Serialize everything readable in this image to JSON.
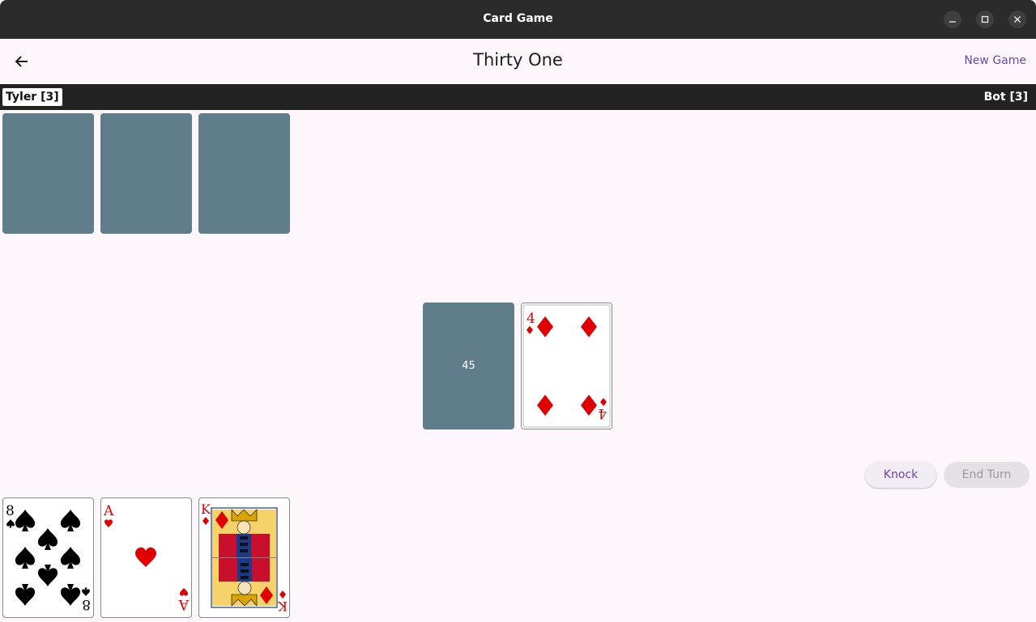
{
  "window": {
    "title": "Card Game",
    "controls": [
      "minimize-icon",
      "maximize-icon",
      "close-icon"
    ]
  },
  "appbar": {
    "back_icon": "arrow-left-icon",
    "title": "Thirty One",
    "new_game_label": "New Game"
  },
  "players": {
    "left": "Tyler [3]",
    "right": "Bot [3]"
  },
  "opponent_hand": {
    "card_count": 3,
    "face": "down"
  },
  "deck": {
    "count": "45"
  },
  "discard": {
    "rank": "4",
    "suit": "diamonds"
  },
  "actions": {
    "knock_label": "Knock",
    "end_turn_label": "End Turn"
  },
  "player_hand": [
    {
      "rank": "8",
      "suit": "spades"
    },
    {
      "rank": "A",
      "suit": "hearts"
    },
    {
      "rank": "K",
      "suit": "diamonds"
    }
  ],
  "colors": {
    "card_back": "#607d8b",
    "accent": "#6a43b8",
    "red_suit": "#e00000",
    "black_suit": "#000000"
  }
}
